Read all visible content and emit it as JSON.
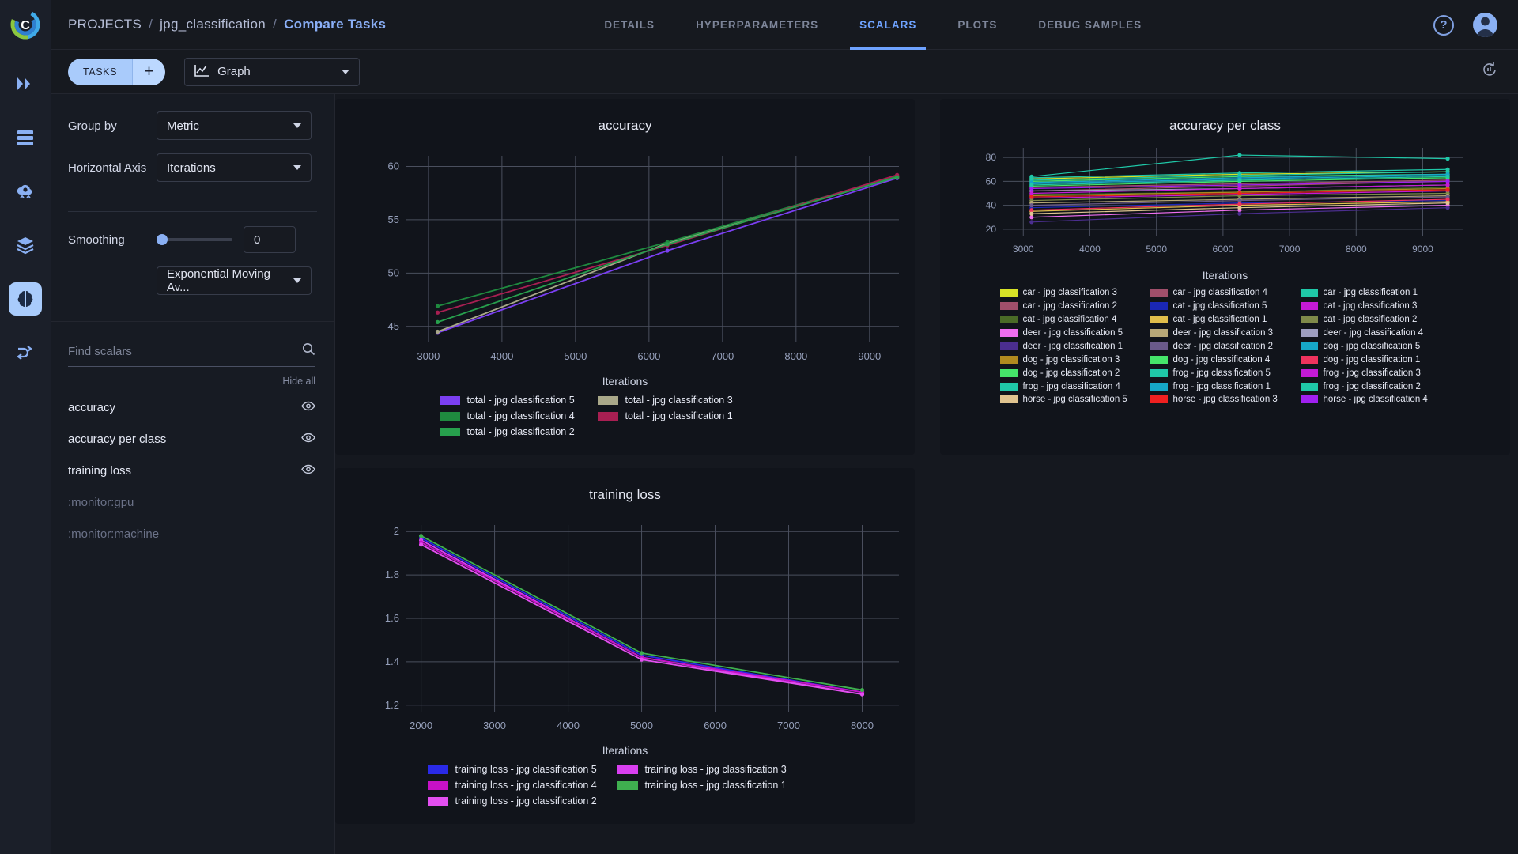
{
  "header": {
    "logo": "clearml-logo",
    "breadcrumb": {
      "root": "PROJECTS",
      "project": "jpg_classification",
      "current": "Compare Tasks",
      "separator": "/"
    },
    "nav": [
      {
        "label": "DETAILS",
        "active": false
      },
      {
        "label": "HYPERPARAMETERS",
        "active": false
      },
      {
        "label": "SCALARS",
        "active": true
      },
      {
        "label": "PLOTS",
        "active": false
      },
      {
        "label": "DEBUG SAMPLES",
        "active": false
      }
    ],
    "help_icon": "?",
    "avatar": "user-avatar"
  },
  "rail": [
    {
      "name": "pipelines-icon"
    },
    {
      "name": "datasets-icon"
    },
    {
      "name": "cloud-compute-icon"
    },
    {
      "name": "models-icon"
    },
    {
      "name": "experiments-icon",
      "active": true
    },
    {
      "name": "workflows-icon"
    }
  ],
  "toolbar": {
    "tasks_label": "TASKS",
    "add_label": "+",
    "graph_select": {
      "value": "Graph",
      "icon": "line-chart-icon"
    },
    "refresh_icon": "auto-refresh-icon"
  },
  "controls": {
    "group_by": {
      "label": "Group by",
      "value": "Metric"
    },
    "horizontal_axis": {
      "label": "Horizontal Axis",
      "value": "Iterations"
    },
    "smoothing": {
      "label": "Smoothing",
      "value": "0",
      "slider_percent": 0
    },
    "smoothing_type": {
      "value": "Exponential Moving Av..."
    }
  },
  "scalars_panel": {
    "search_placeholder": "Find scalars",
    "search_value": "",
    "hide_all_label": "Hide all",
    "items": [
      {
        "label": "accuracy",
        "visible": true,
        "dim": false
      },
      {
        "label": "accuracy per class",
        "visible": true,
        "dim": false
      },
      {
        "label": "training loss",
        "visible": true,
        "dim": false
      },
      {
        "label": ":monitor:gpu",
        "visible": false,
        "dim": true
      },
      {
        "label": ":monitor:machine",
        "visible": false,
        "dim": true
      }
    ]
  },
  "chart_data": [
    {
      "id": "accuracy",
      "type": "line",
      "title": "accuracy",
      "xlabel": "Iterations",
      "ylabel": "",
      "xticks": [
        3000,
        4000,
        5000,
        6000,
        7000,
        8000,
        9000
      ],
      "yticks": [
        45,
        50,
        55,
        60
      ],
      "xlim": [
        2700,
        9400
      ],
      "ylim": [
        43.5,
        61
      ],
      "grid": true,
      "legend_position": "bottom",
      "x": [
        3125,
        6250,
        9375
      ],
      "series": [
        {
          "name": "total - jpg classification 5",
          "color": "#7b3ff2",
          "values": [
            44.4,
            52.1,
            58.9
          ]
        },
        {
          "name": "total - jpg classification 3",
          "color": "#a9a889",
          "values": [
            44.5,
            52.8,
            59.0
          ]
        },
        {
          "name": "total - jpg classification 4",
          "color": "#1f8a3f",
          "values": [
            46.9,
            52.9,
            59.1
          ]
        },
        {
          "name": "total - jpg classification 1",
          "color": "#a81f52",
          "values": [
            46.3,
            52.6,
            59.2
          ]
        },
        {
          "name": "total - jpg classification 2",
          "color": "#27a04d",
          "values": [
            45.4,
            52.7,
            59.0
          ]
        }
      ]
    },
    {
      "id": "accuracy_per_class",
      "type": "line",
      "title": "accuracy per class",
      "xlabel": "Iterations",
      "ylabel": "",
      "xticks": [
        3000,
        4000,
        5000,
        6000,
        7000,
        8000,
        9000
      ],
      "yticks": [
        20,
        40,
        60,
        80
      ],
      "xlim": [
        2700,
        9600
      ],
      "ylim": [
        14,
        88
      ],
      "grid": true,
      "legend_position": "bottom",
      "x": [
        3125,
        6250,
        9375
      ],
      "series": [
        {
          "name": "car - jpg classification 3",
          "color": "#d8e327",
          "values": [
            62,
            66,
            68
          ]
        },
        {
          "name": "car - jpg classification 4",
          "color": "#a04f6b",
          "values": [
            55,
            58,
            61
          ]
        },
        {
          "name": "car - jpg classification 1",
          "color": "#1fc8a8",
          "values": [
            64,
            82,
            79
          ]
        },
        {
          "name": "car - jpg classification 2",
          "color": "#a04f6b",
          "values": [
            52,
            56,
            60
          ]
        },
        {
          "name": "cat - jpg classification 5",
          "color": "#1a27b5",
          "values": [
            38,
            42,
            44
          ]
        },
        {
          "name": "cat - jpg classification 3",
          "color": "#c41ad6",
          "values": [
            46,
            49,
            52
          ]
        },
        {
          "name": "cat - jpg classification 4",
          "color": "#4a6b27",
          "values": [
            49,
            51,
            55
          ]
        },
        {
          "name": "cat - jpg classification 1",
          "color": "#e0bd4b",
          "values": [
            35,
            40,
            43
          ]
        },
        {
          "name": "cat - jpg classification 2",
          "color": "#7f8a4a",
          "values": [
            44,
            48,
            50
          ]
        },
        {
          "name": "deer - jpg classification 5",
          "color": "#ef6ef0",
          "values": [
            30,
            36,
            40
          ]
        },
        {
          "name": "deer - jpg classification 3",
          "color": "#b8a878",
          "values": [
            42,
            45,
            48
          ]
        },
        {
          "name": "deer - jpg classification 4",
          "color": "#9e9ec0",
          "values": [
            52,
            54,
            57
          ]
        },
        {
          "name": "deer - jpg classification 1",
          "color": "#4b2e8f",
          "values": [
            26,
            33,
            38
          ]
        },
        {
          "name": "deer - jpg classification 2",
          "color": "#6a5a8a",
          "values": [
            40,
            44,
            47
          ]
        },
        {
          "name": "dog - jpg classification 5",
          "color": "#16a8c8",
          "values": [
            58,
            62,
            65
          ]
        },
        {
          "name": "dog - jpg classification 3",
          "color": "#b08a1f",
          "values": [
            48,
            51,
            54
          ]
        },
        {
          "name": "dog - jpg classification 4",
          "color": "#45e56a",
          "values": [
            60,
            64,
            66
          ]
        },
        {
          "name": "dog - jpg classification 1",
          "color": "#f0335e",
          "values": [
            36,
            41,
            45
          ]
        },
        {
          "name": "dog - jpg classification 2",
          "color": "#45e56a",
          "values": [
            56,
            60,
            63
          ]
        },
        {
          "name": "frog - jpg classification 5",
          "color": "#1fc8a8",
          "values": [
            63,
            67,
            70
          ]
        },
        {
          "name": "frog - jpg classification 3",
          "color": "#c41ad6",
          "values": [
            50,
            54,
            57
          ]
        },
        {
          "name": "frog - jpg classification 4",
          "color": "#1fc8a8",
          "values": [
            61,
            65,
            68
          ]
        },
        {
          "name": "frog - jpg classification 1",
          "color": "#16a8c8",
          "values": [
            59,
            63,
            66
          ]
        },
        {
          "name": "frog - jpg classification 2",
          "color": "#1fc8a8",
          "values": [
            57,
            61,
            64
          ]
        },
        {
          "name": "horse - jpg classification 5",
          "color": "#e0c490",
          "values": [
            33,
            38,
            42
          ]
        },
        {
          "name": "horse - jpg classification 3",
          "color": "#ef2020",
          "values": [
            47,
            50,
            53
          ]
        },
        {
          "name": "horse - jpg classification 4",
          "color": "#a020f0",
          "values": [
            54,
            57,
            60
          ]
        }
      ]
    },
    {
      "id": "training_loss",
      "type": "line",
      "title": "training loss",
      "xlabel": "Iterations",
      "ylabel": "",
      "xticks": [
        2000,
        3000,
        4000,
        5000,
        6000,
        7000,
        8000
      ],
      "yticks": [
        1.2,
        1.4,
        1.6,
        1.8,
        2.0
      ],
      "xlim": [
        1800,
        8500
      ],
      "ylim": [
        1.17,
        2.03
      ],
      "grid": true,
      "legend_position": "bottom",
      "x": [
        2000,
        5000,
        8000
      ],
      "series": [
        {
          "name": "training loss - jpg classification 5",
          "color": "#2a2ae8",
          "values": [
            1.97,
            1.43,
            1.26
          ]
        },
        {
          "name": "training loss - jpg classification 3",
          "color": "#d93ff0",
          "values": [
            1.96,
            1.42,
            1.25
          ]
        },
        {
          "name": "training loss - jpg classification 4",
          "color": "#c711c7",
          "values": [
            1.95,
            1.42,
            1.26
          ]
        },
        {
          "name": "training loss - jpg classification 1",
          "color": "#3faf4f",
          "values": [
            1.98,
            1.44,
            1.27
          ]
        },
        {
          "name": "training loss - jpg classification 2",
          "color": "#e34ff0",
          "values": [
            1.94,
            1.41,
            1.25
          ]
        }
      ]
    }
  ]
}
